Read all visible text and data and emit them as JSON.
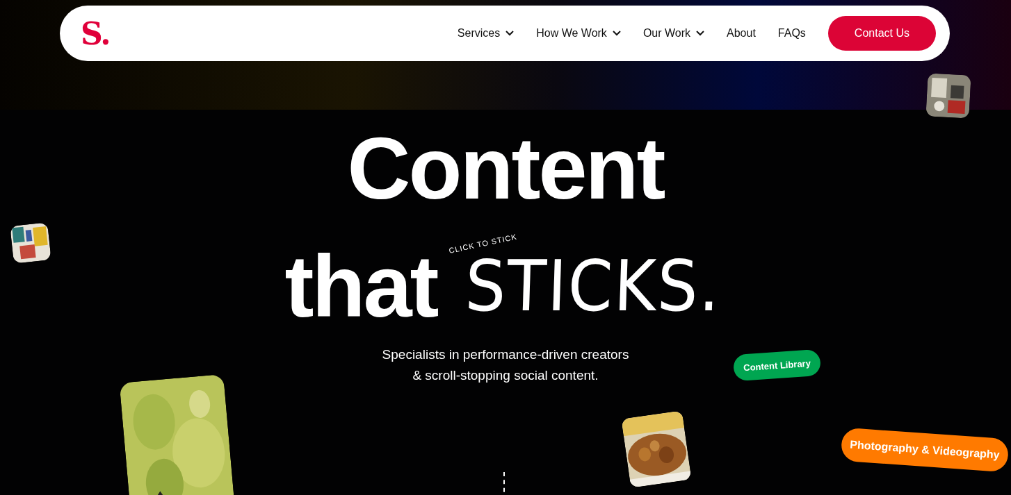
{
  "logo": {
    "text": "S."
  },
  "nav": {
    "items": [
      {
        "label": "Services",
        "dropdown": true
      },
      {
        "label": "How We Work",
        "dropdown": true
      },
      {
        "label": "Our Work",
        "dropdown": true
      },
      {
        "label": "About",
        "dropdown": false
      },
      {
        "label": "FAQs",
        "dropdown": false
      }
    ],
    "cta": "Contact Us"
  },
  "hero": {
    "title_line1": "Content",
    "title_word": "that",
    "title_script": "STICKS.",
    "script_hint": "CLICK TO STICK",
    "subtitle": "Specialists in performance-driven creators\n& scroll-stopping social content."
  },
  "tags": [
    {
      "label": "Content Library",
      "color": "#00a651"
    },
    {
      "label": "Photography & Videography",
      "color": "#ff7a00"
    }
  ]
}
